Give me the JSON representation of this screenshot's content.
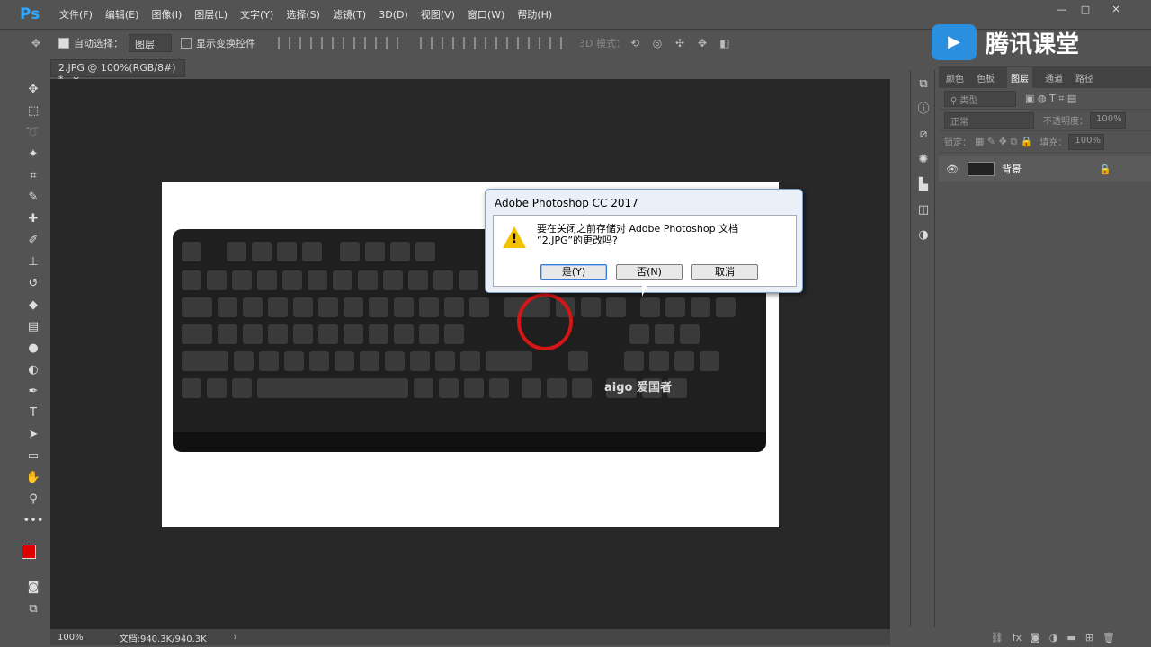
{
  "app": {
    "logo_text": "Ps"
  },
  "menu": [
    "文件(F)",
    "编辑(E)",
    "图像(I)",
    "图层(L)",
    "文字(Y)",
    "选择(S)",
    "滤镜(T)",
    "3D(D)",
    "视图(V)",
    "窗口(W)",
    "帮助(H)"
  ],
  "options": {
    "auto_select_label": "自动选择：",
    "auto_select_value": "图层",
    "show_transform_label": "显示变换控件",
    "mode_3d_label": "3D 模式："
  },
  "document": {
    "tab_label": "2.JPG @ 100%(RGB/8#) *",
    "close_label": "×"
  },
  "keyboard": {
    "brand": "aigo 爱国者"
  },
  "status": {
    "zoom": "100%",
    "doc_info": "文档:940.3K/940.3K",
    "arrow": "›"
  },
  "panel": {
    "tabs": [
      "颜色",
      "色板",
      "图层",
      "通道",
      "路径"
    ],
    "active_tab": "图层",
    "search_placeholder": "类型",
    "blend_mode": "正常",
    "opacity_label": "不透明度：",
    "opacity_value": "100%",
    "lock_label": "锁定：",
    "fill_label": "填充：",
    "fill_value": "100%",
    "layer_name": "背景"
  },
  "watermark": {
    "text": "腾讯课堂"
  },
  "dialog": {
    "title": "Adobe Photoshop CC 2017",
    "line1": "要在关闭之前存储对 Adobe Photoshop 文档",
    "line2": "“2.JPG”的更改吗?",
    "btn_yes": "是(Y)",
    "btn_no": "否(N)",
    "btn_cancel": "取消"
  },
  "colors": {
    "foreground": "#e00000",
    "background": "#000000",
    "accent": "#31a8ff"
  }
}
